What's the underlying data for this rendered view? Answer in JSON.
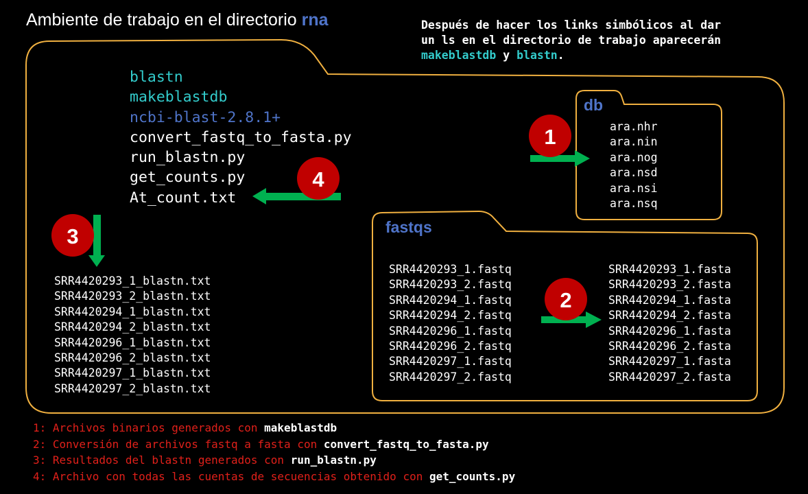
{
  "title": {
    "text": "Ambiente de trabajo en el directorio ",
    "dir": "rna"
  },
  "note": {
    "line1": "Después de hacer los links simbólicos al dar",
    "line2": "un ls en el directorio de trabajo aparecerán",
    "prog1": "makeblastdb",
    "mid": " y ",
    "prog2": "blastn",
    "end": "."
  },
  "main_listing": {
    "items": [
      "blastn",
      "makeblastdb",
      "ncbi-blast-2.8.1+",
      "convert_fastq_to_fasta.py",
      "run_blastn.py",
      "get_counts.py",
      "At_count.txt"
    ]
  },
  "db_folder": {
    "label": "db",
    "files": [
      "ara.nhr",
      "ara.nin",
      "ara.nog",
      "ara.nsd",
      "ara.nsi",
      "ara.nsq"
    ]
  },
  "fastqs_folder": {
    "label": "fastqs",
    "fastq_files": [
      "SRR4420293_1.fastq",
      "SRR4420293_2.fastq",
      "SRR4420294_1.fastq",
      "SRR4420294_2.fastq",
      "SRR4420296_1.fastq",
      "SRR4420296_2.fastq",
      "SRR4420297_1.fastq",
      "SRR4420297_2.fastq"
    ],
    "fasta_files": [
      "SRR4420293_1.fasta",
      "SRR4420293_2.fasta",
      "SRR4420294_1.fasta",
      "SRR4420294_2.fasta",
      "SRR4420296_1.fasta",
      "SRR4420296_2.fasta",
      "SRR4420297_1.fasta",
      "SRR4420297_2.fasta"
    ]
  },
  "blastn_results": [
    "SRR4420293_1_blastn.txt",
    "SRR4420293_2_blastn.txt",
    "SRR4420294_1_blastn.txt",
    "SRR4420294_2_blastn.txt",
    "SRR4420296_1_blastn.txt",
    "SRR4420296_2_blastn.txt",
    "SRR4420297_1_blastn.txt",
    "SRR4420297_2_blastn.txt"
  ],
  "steps": [
    "1",
    "2",
    "3",
    "4"
  ],
  "legend": [
    {
      "text": "1: Archivos binarios generados con ",
      "program": "makeblastdb"
    },
    {
      "text": "2: Conversión de archivos fastq a fasta con ",
      "program": "convert_fastq_to_fasta.py"
    },
    {
      "text": "3: Resultados del blastn generados con ",
      "program": "run_blastn.py"
    },
    {
      "text": "4: Archivo con todas las cuentas de secuencias obtenido con ",
      "program": "get_counts.py"
    }
  ],
  "colors": {
    "background": "#000000",
    "folder_outline": "#f0b040",
    "step_badge": "#c00000",
    "arrow": "#00b050",
    "cyan_text": "#33cccc",
    "blue_text": "#4f74c9",
    "legend_text": "#e0201a"
  }
}
